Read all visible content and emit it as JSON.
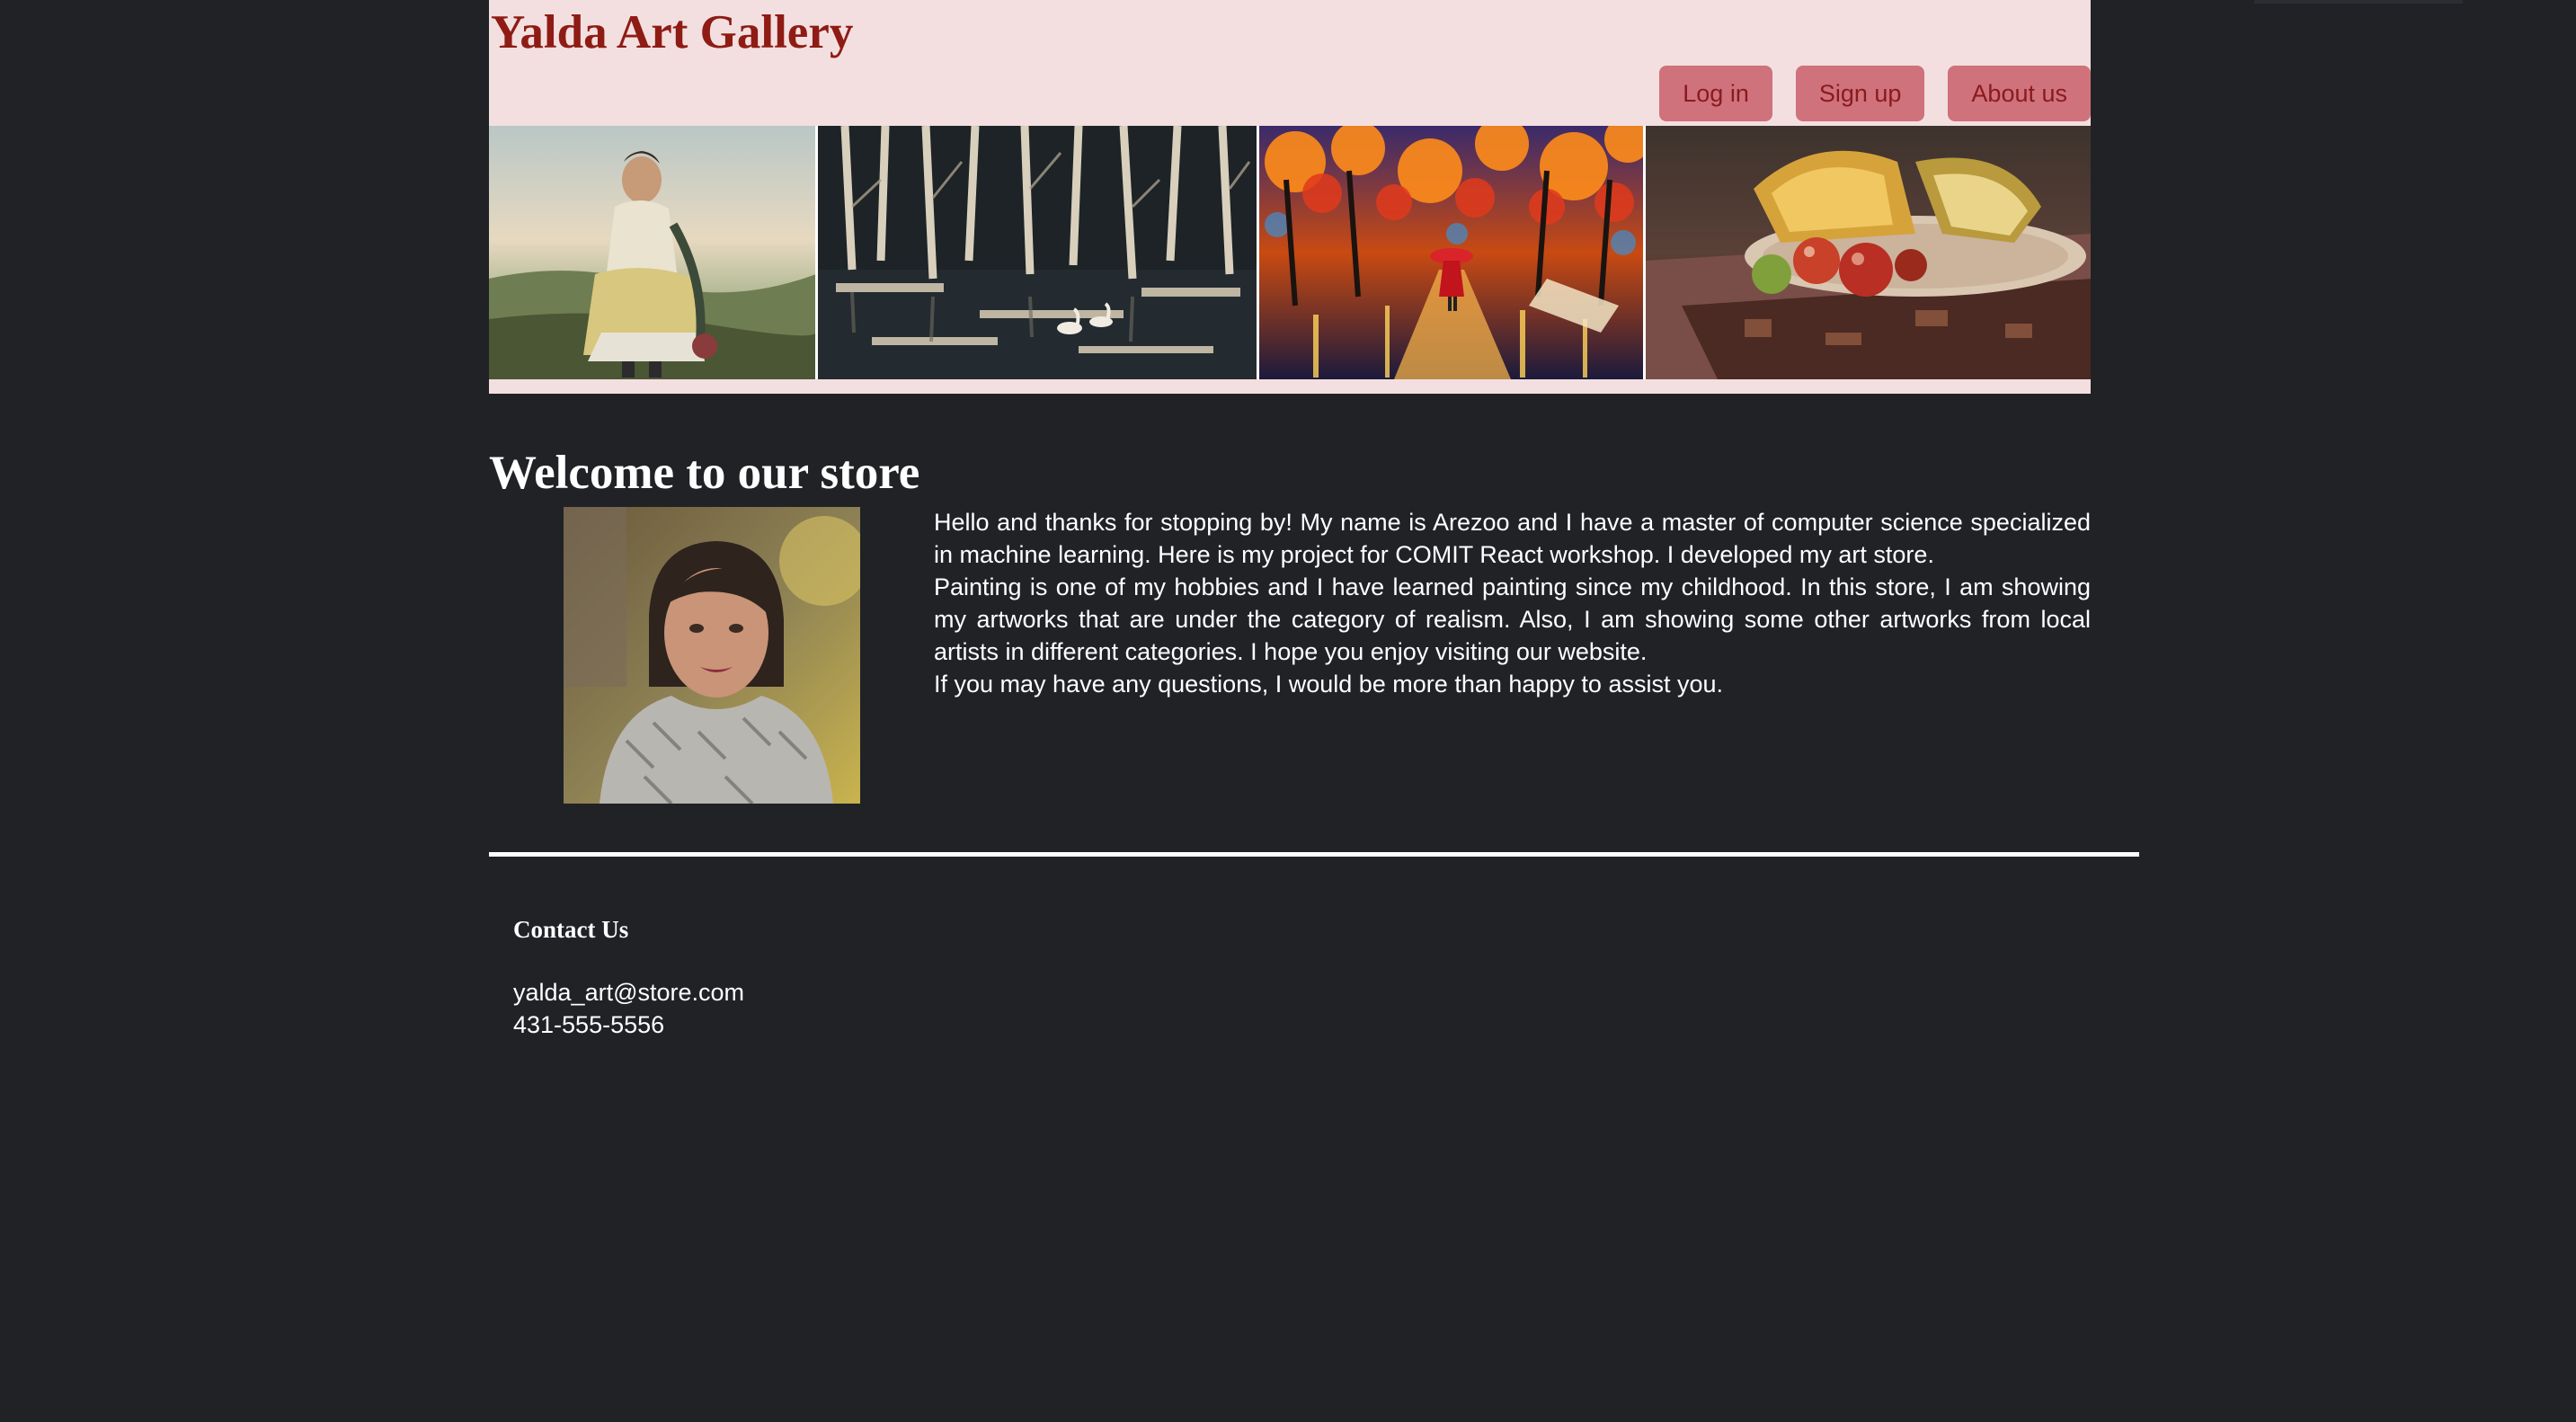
{
  "header": {
    "brand": "Yalda Art Gallery",
    "nav": {
      "login": "Log in",
      "signup": "Sign up",
      "about": "About us"
    }
  },
  "gallery": {
    "items": [
      {
        "icon": "painting-woman-by-sea"
      },
      {
        "icon": "painting-birch-forest-swans"
      },
      {
        "icon": "painting-rainy-autumn-street"
      },
      {
        "icon": "painting-fruit-still-life"
      }
    ]
  },
  "welcome": {
    "title": "Welcome to our store",
    "portrait_icon": "portrait-photo",
    "paragraph1": "Hello and thanks for stopping by! My name is Arezoo and I have a master of computer science specialized in machine learning. Here is my project for COMIT React workshop. I developed my art store.",
    "paragraph2": "Painting is one of my hobbies and I have learned painting since my childhood. In this store, I am showing my artworks that are under the category of realism. Also, I am showing some other artworks from local artists in different categories. I hope you enjoy visiting our website.",
    "paragraph3": "If you may have any questions, I would be more than happy to assist you."
  },
  "contact": {
    "title": "Contact Us",
    "email": "yalda_art@store.com",
    "phone": "431-555-5556"
  },
  "colors": {
    "page_background": "#202226",
    "header_background": "#f3dfe0",
    "brand": "#8e1c14",
    "nav_button": "#cf727b",
    "nav_text": "#8a1a1e"
  }
}
